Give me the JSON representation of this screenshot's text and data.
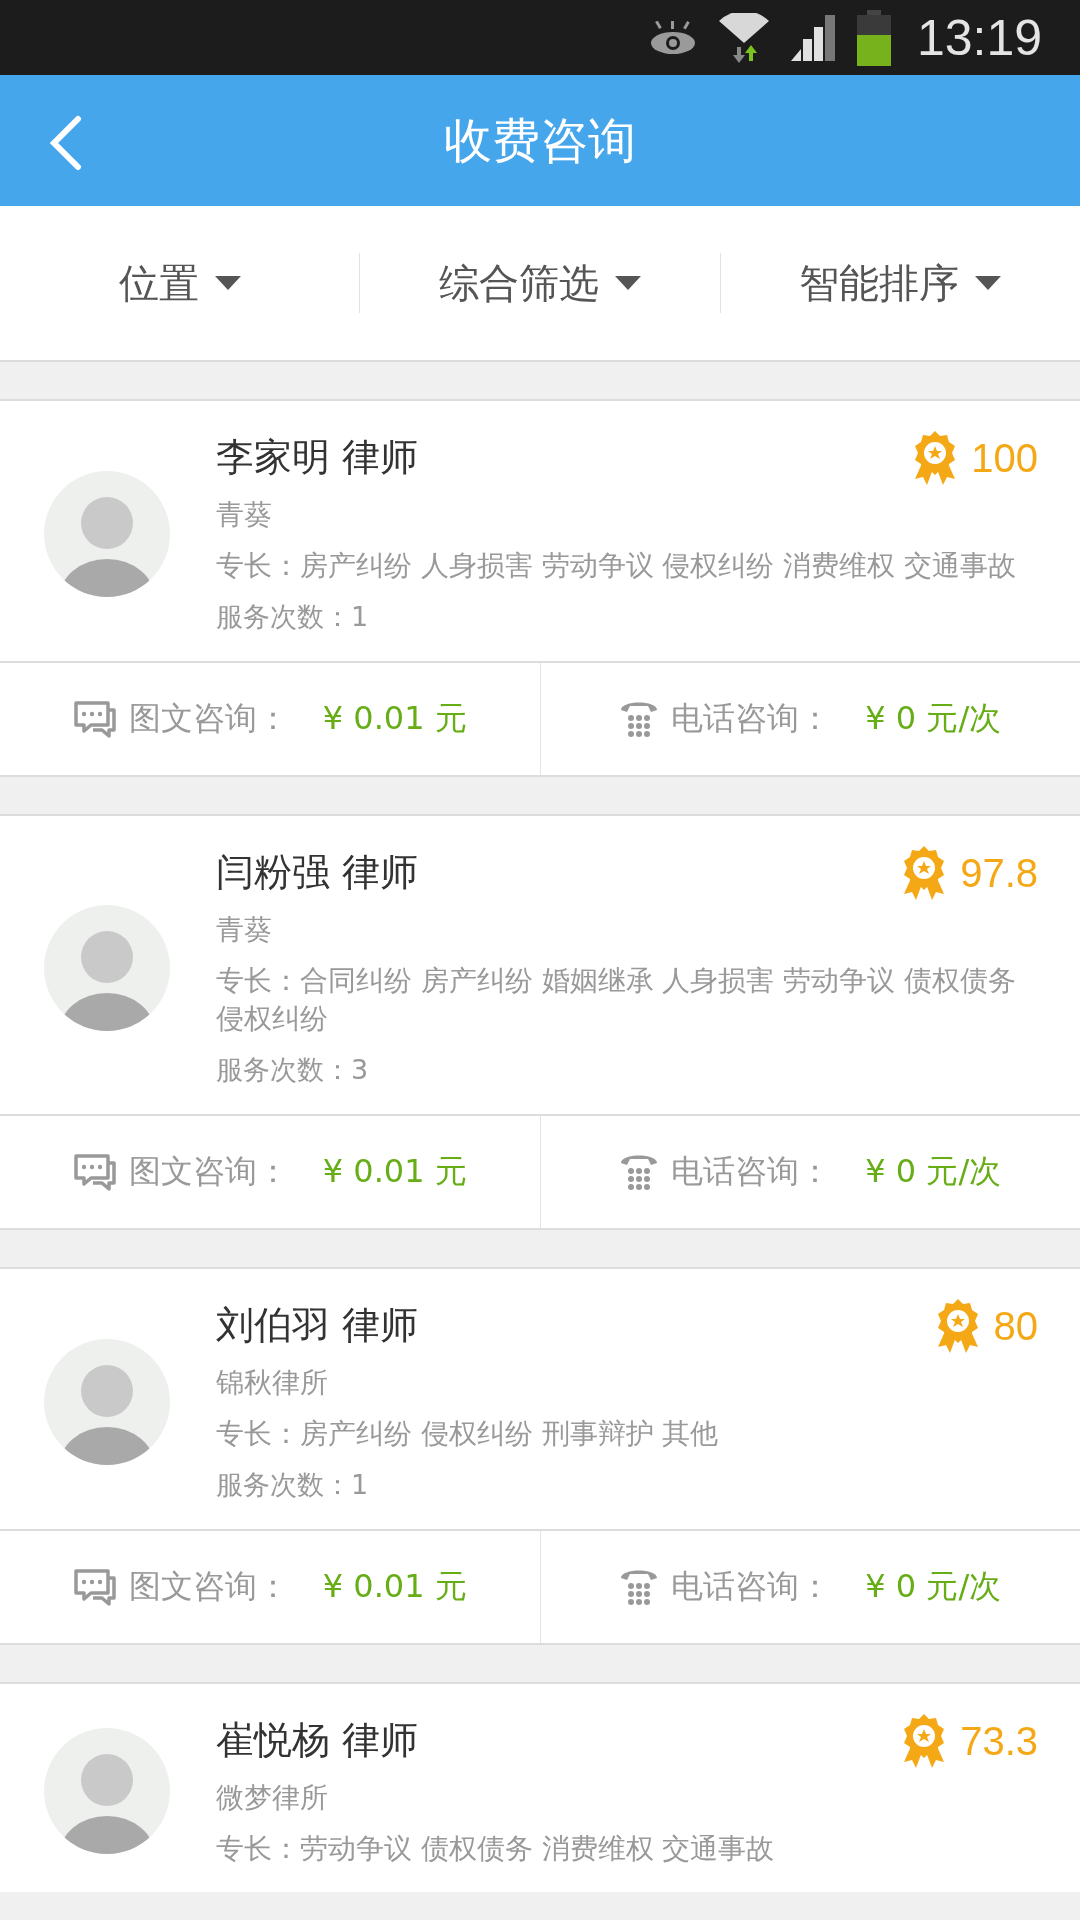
{
  "status_bar": {
    "time": "13:19"
  },
  "header": {
    "title": "收费咨询"
  },
  "filters": [
    {
      "label": "位置"
    },
    {
      "label": "综合筛选"
    },
    {
      "label": "智能排序"
    }
  ],
  "lawyers": [
    {
      "name": "李家明 律师",
      "firm": "青葵",
      "specialties": "专长：房产纠纷 人身损害 劳动争议 侵权纠纷 消费维权 交通事故",
      "service_count": "服务次数：1",
      "score": "100",
      "consult_options": [
        {
          "kind": "message",
          "label": "图文咨询：",
          "price": "¥ 0.01 元"
        },
        {
          "kind": "phone",
          "label": "电话咨询：",
          "price": "¥ 0 元/次"
        }
      ]
    },
    {
      "name": "闫粉强 律师",
      "firm": "青葵",
      "specialties": "专长：合同纠纷 房产纠纷 婚姻继承 人身损害 劳动争议 债权债务侵权纠纷",
      "service_count": "服务次数：3",
      "score": "97.8",
      "consult_options": [
        {
          "kind": "message",
          "label": "图文咨询：",
          "price": "¥ 0.01 元"
        },
        {
          "kind": "phone",
          "label": "电话咨询：",
          "price": "¥ 0 元/次"
        }
      ]
    },
    {
      "name": "刘伯羽 律师",
      "firm": "锦秋律所",
      "specialties": "专长：房产纠纷 侵权纠纷 刑事辩护 其他",
      "service_count": "服务次数：1",
      "score": "80",
      "consult_options": [
        {
          "kind": "message",
          "label": "图文咨询：",
          "price": "¥ 0.01 元"
        },
        {
          "kind": "phone",
          "label": "电话咨询：",
          "price": "¥ 0 元/次"
        }
      ]
    },
    {
      "name": "崔悦杨 律师",
      "firm": "微梦律所",
      "specialties": "专长：劳动争议 债权债务 消费维权 交通事故",
      "score": "73.3"
    }
  ]
}
